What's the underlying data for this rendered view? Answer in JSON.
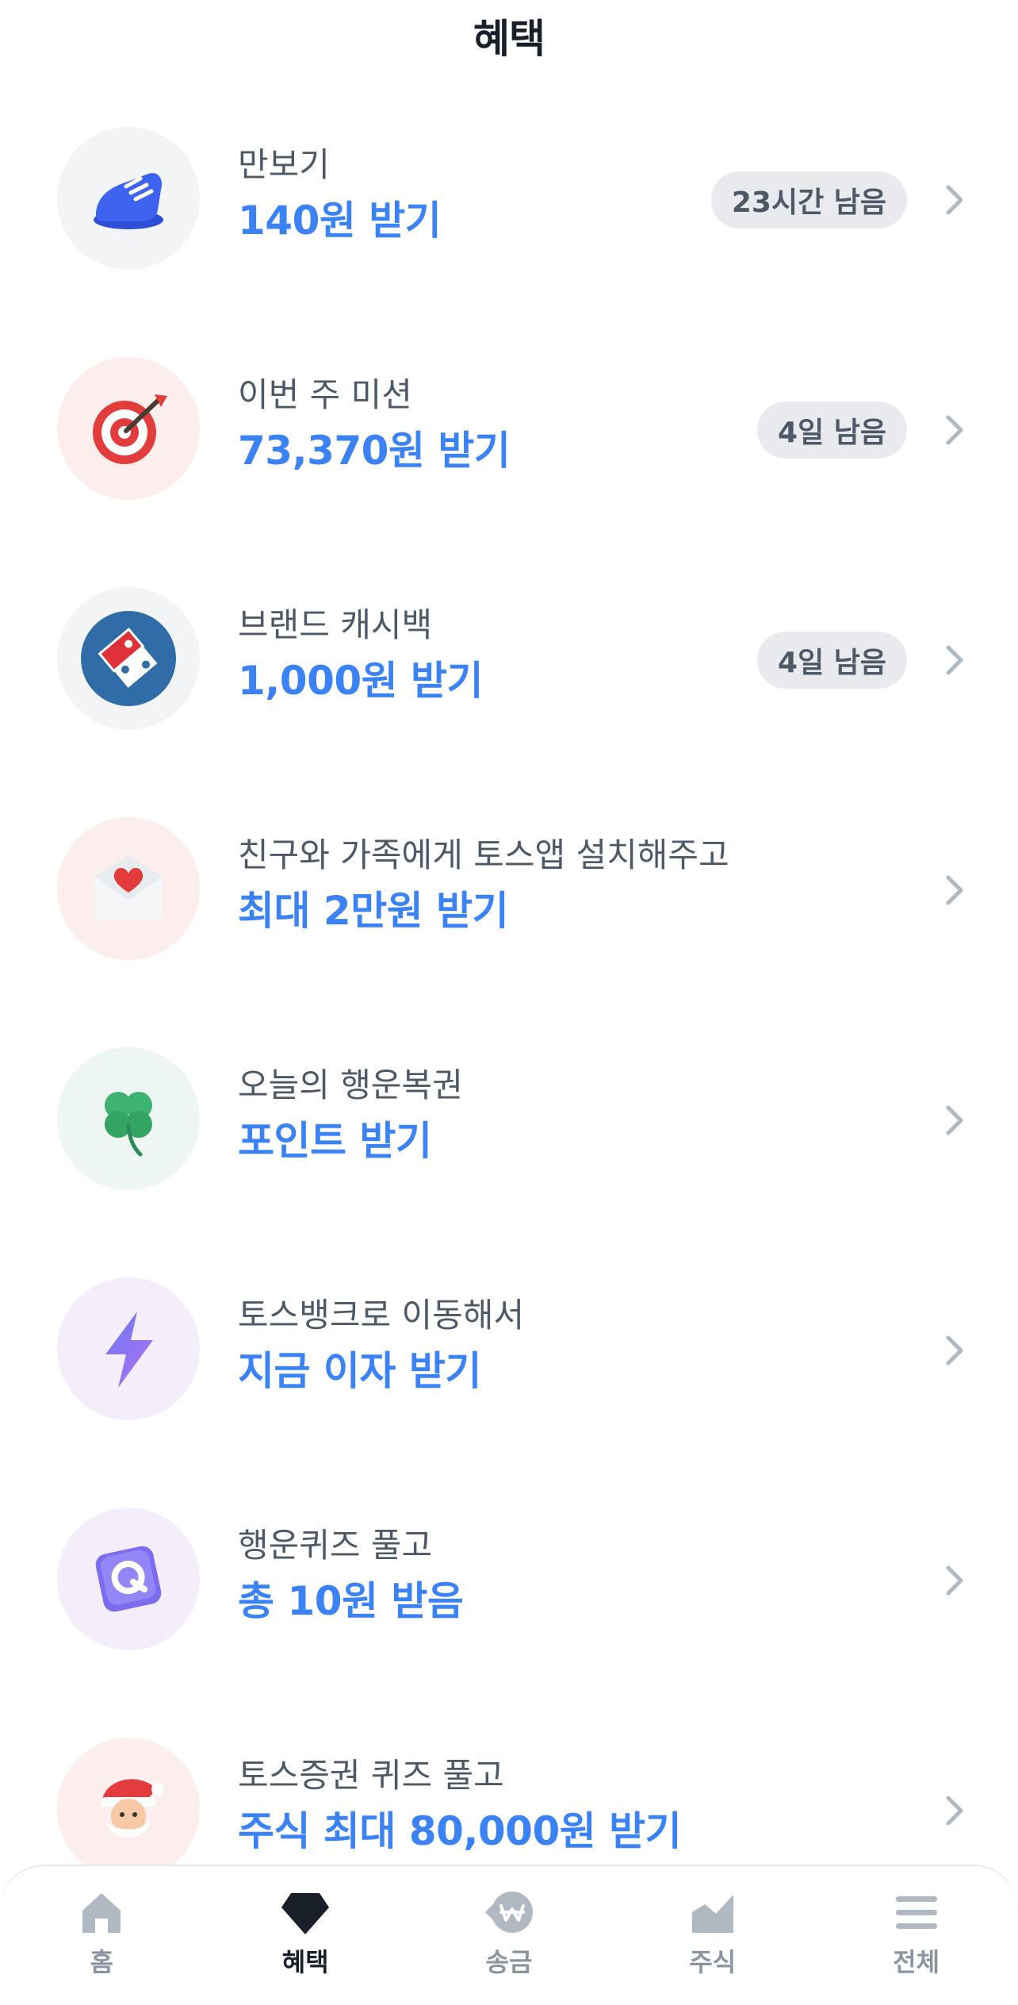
{
  "header": {
    "title": "혜택"
  },
  "items": [
    {
      "title": "만보기",
      "subtitle": "140원 받기",
      "badge": "23시간 남음",
      "icon": "shoe-icon",
      "bg": "#f2f4f6"
    },
    {
      "title": "이번 주 미션",
      "subtitle": "73,370원 받기",
      "badge": "4일 남음",
      "icon": "target-icon",
      "bg": "#fdeeee"
    },
    {
      "title": "브랜드 캐시백",
      "subtitle": "1,000원 받기",
      "badge": "4일 남음",
      "icon": "dominos-logo-icon",
      "bg": "#f2f4f6"
    },
    {
      "title": "친구와 가족에게 토스앱 설치해주고",
      "subtitle": "최대 2만원 받기",
      "icon": "heart-envelope-icon",
      "bg": "#fdeeee"
    },
    {
      "title": "오늘의 행운복권",
      "subtitle": "포인트 받기",
      "icon": "clover-icon",
      "bg": "#eef6f3"
    },
    {
      "title": "토스뱅크로 이동해서",
      "subtitle": "지금 이자 받기",
      "icon": "lightning-icon",
      "bg": "#f4eefb"
    },
    {
      "title": "행운퀴즈 풀고",
      "subtitle": "총 10원 받음",
      "icon": "quiz-q-icon",
      "bg": "#f4eefb"
    },
    {
      "title": "토스증권 퀴즈 풀고",
      "subtitle": "주식 최대 80,000원 받기",
      "icon": "santa-icon",
      "bg": "#fdeeee"
    }
  ],
  "tabbar": {
    "tabs": [
      {
        "label": "홈",
        "icon": "home-icon"
      },
      {
        "label": "혜택",
        "icon": "diamond-icon",
        "active": true
      },
      {
        "label": "송금",
        "icon": "won-transfer-icon"
      },
      {
        "label": "주식",
        "icon": "chart-icon"
      },
      {
        "label": "전체",
        "icon": "menu-icon"
      }
    ]
  },
  "colors": {
    "accent": "#3b82f6",
    "badge_bg": "#e8eaed",
    "title_text": "#4e5968",
    "header_text": "#191f28"
  }
}
